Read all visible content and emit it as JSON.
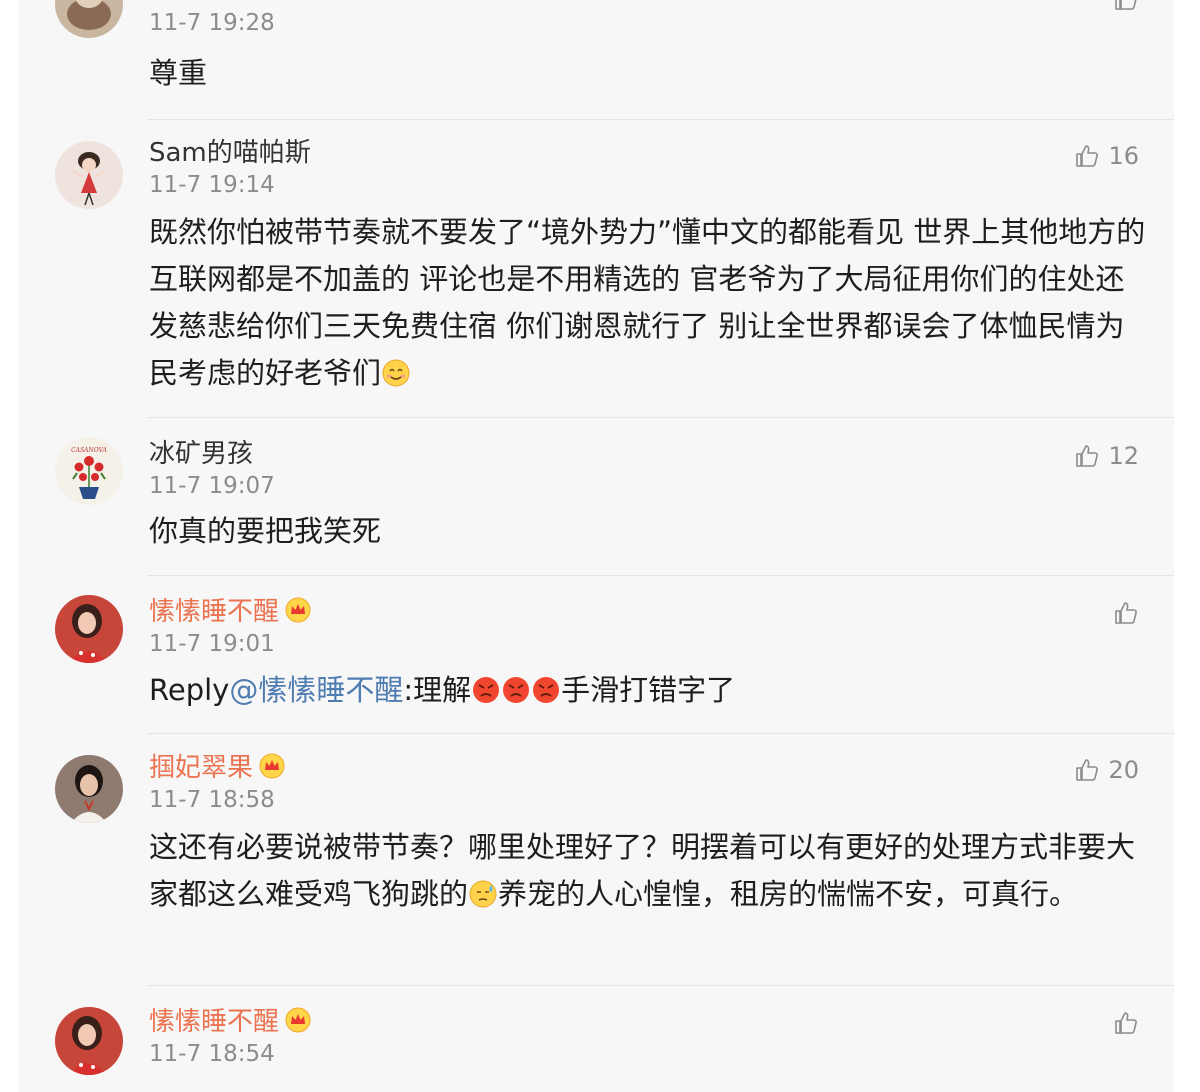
{
  "colors": {
    "vip_name": "#eb7350",
    "mention": "#4f7cb1",
    "timestamp": "#8c8c8c",
    "background": "#f7f7f8",
    "divider": "#e4e4e6"
  },
  "comments": [
    {
      "name": "",
      "time": "11-7 19:28",
      "text": "尊重",
      "likes": "",
      "vip": false,
      "avatar_icon": "user-avatar-icon"
    },
    {
      "name": "Sam的喵帕斯",
      "time": "11-7 19:14",
      "text": "既然你怕被带节奏就不要发了“境外势力”懂中文的都能看见 世界上其他地方的互联网都是不加盖的 评论也是不用精选的 官老爷为了大局征用你们的住处还发慈悲给你们三天免费住宿 你们谢恩就行了 别让全世界都误会了体恤民情为民考虑的好老爷们",
      "emoji": "smile-emoji-icon",
      "likes": "16",
      "vip": false,
      "avatar_icon": "cartoon-girl-avatar-icon"
    },
    {
      "name": "冰矿男孩",
      "time": "11-7 19:07",
      "text": "你真的要把我笑死",
      "likes": "12",
      "vip": false,
      "avatar_icon": "flower-pot-avatar-icon"
    },
    {
      "name": "愫愫睡不醒",
      "time": "11-7 19:01",
      "reply_prefix": "Reply",
      "mention": "@愫愫睡不醒",
      "text_after_mention": ":理解",
      "text_end": "手滑打错字了",
      "emoji": "angry-emoji-icon",
      "likes": "",
      "vip": true,
      "avatar_icon": "woman-avatar-icon"
    },
    {
      "name": "掴妃翠果",
      "time": "11-7 18:58",
      "text_part1": "这还有必要说被带节奏？哪里处理好了？明摆着可以有更好的处理方式非要大家都这么难受鸡飞狗跳的",
      "text_part2": "养宠的人心惶惶，租房的惴惴不安，可真行。",
      "emoji": "sweat-emoji-icon",
      "likes": "20",
      "vip": true,
      "avatar_icon": "woman-avatar-icon"
    },
    {
      "name": "愫愫睡不醒",
      "time": "11-7 18:54",
      "text": "",
      "likes": "",
      "vip": true,
      "avatar_icon": "woman-avatar-icon"
    }
  ]
}
